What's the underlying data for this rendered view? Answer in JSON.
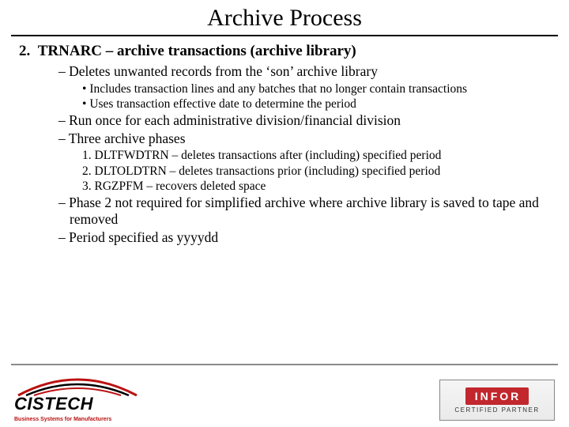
{
  "title": "Archive Process",
  "main_item": {
    "number": "2.",
    "label": "TRNARC – archive transactions (archive library)"
  },
  "dash1": "Deletes unwanted records from the ‘son’ archive library",
  "bullets1": [
    "Includes transaction lines and any batches that no longer contain transactions",
    "Uses transaction effective date to determine the period"
  ],
  "dash2": "Run once for each administrative division/financial division",
  "dash3": "Three archive phases",
  "phases": [
    "1. DLTFWDTRN – deletes transactions after (including) specified period",
    "2. DLTOLDTRN – deletes transactions prior (including) specified period",
    "3. RGZPFM – recovers deleted space"
  ],
  "dash4": "Phase 2 not required for simplified archive where archive library is saved to tape and removed",
  "dash5": "Period specified as yyyydd",
  "logo_left": {
    "name": "CISTECH",
    "tag": "Business Systems for Manufacturers"
  },
  "logo_right": {
    "brand": "INFOR",
    "sub": "CERTIFIED PARTNER"
  }
}
